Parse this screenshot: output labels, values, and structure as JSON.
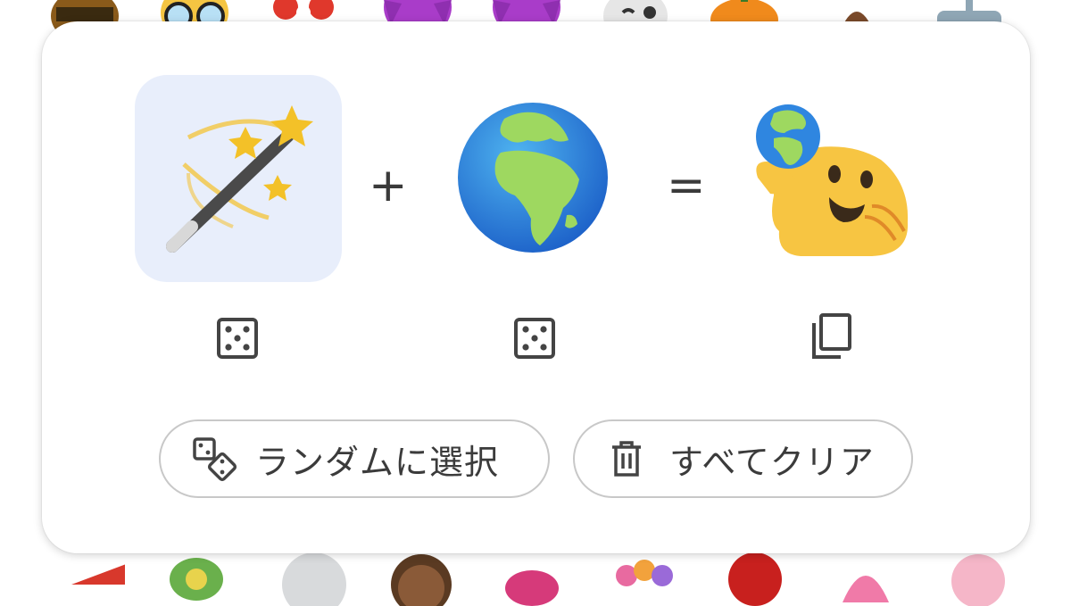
{
  "emoji_kitchen": {
    "left_emoji": "magic-wand-emoji",
    "middle_emoji": "globe-europe-africa-emoji",
    "result_emoji": "hugging-face-with-globe-emoji",
    "plus_sign": "+",
    "equals_sign": "=",
    "left_random_icon": "dice-icon",
    "middle_random_icon": "dice-icon",
    "copy_icon": "copy-icon",
    "random_button_label": "ランダムに選択",
    "clear_button_label": "すべてクリア",
    "random_button_icon": "two-dice-icon",
    "clear_button_icon": "trash-icon"
  },
  "colors": {
    "slot_highlight": "#e8eefb",
    "button_border": "#c8c8c8",
    "text": "#3b3b3b"
  }
}
